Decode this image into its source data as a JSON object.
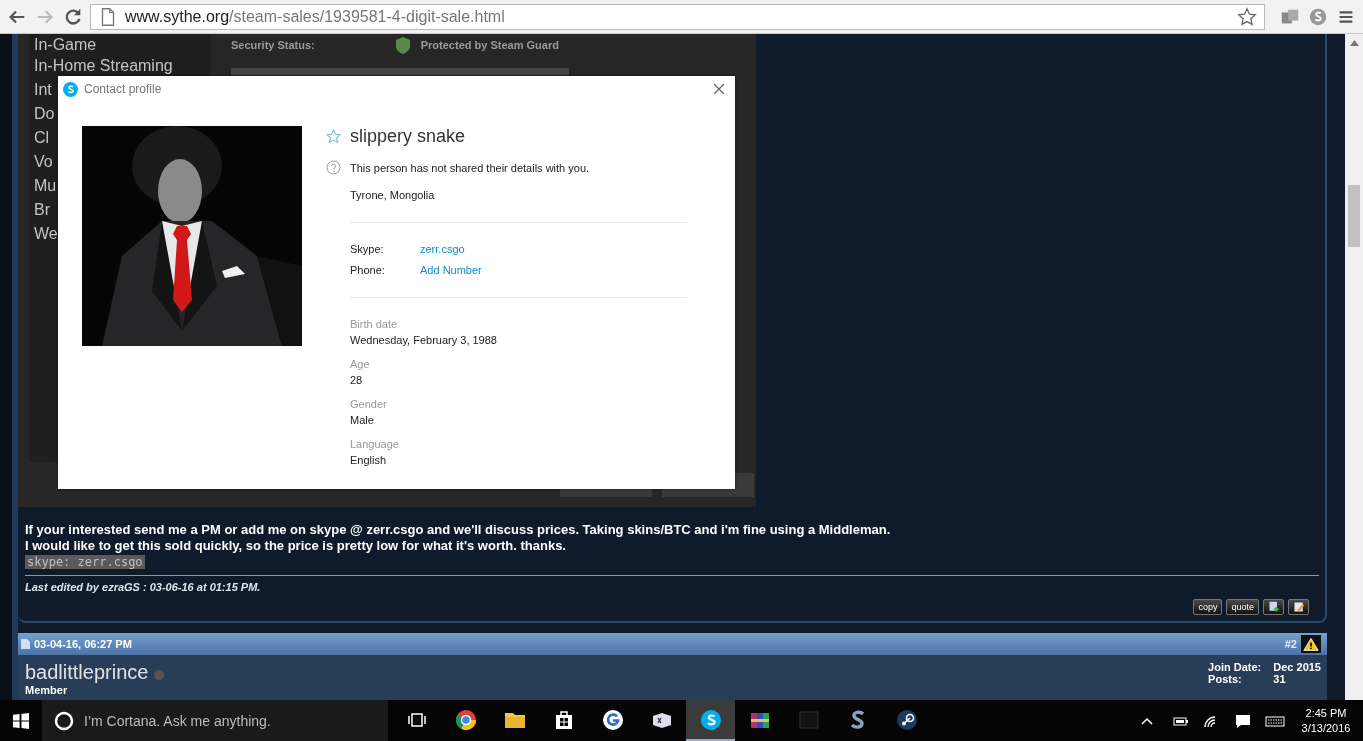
{
  "browser": {
    "url_host": "www.sythe.org",
    "url_path": "/steam-sales/1939581-4-digit-sale.html"
  },
  "steam_screenshot": {
    "security_label": "Security Status:",
    "security_value": "Protected by Steam Guard",
    "menu": [
      "In-Game",
      "In-Home Streaming",
      "Int",
      "Do",
      "Cl",
      "Vo",
      "Mu",
      "Br",
      "We"
    ]
  },
  "dialog": {
    "title": "Contact profile",
    "name": "slippery snake",
    "notice": "This person has not shared their details with you.",
    "location": "Tyrone, Mongolia",
    "contacts": [
      {
        "label": "Skype:",
        "value": "zerr.csgo"
      },
      {
        "label": "Phone:",
        "value": "Add Number"
      }
    ],
    "details": [
      {
        "label": "Birth date",
        "value": "Wednesday, February 3, 1988"
      },
      {
        "label": "Age",
        "value": "28"
      },
      {
        "label": "Gender",
        "value": "Male"
      },
      {
        "label": "Language",
        "value": "English"
      }
    ]
  },
  "post": {
    "lines": [
      "If your interested send me a PM or add me on skype @ zerr.csgo and we'll discuss prices. Taking skins/BTC and i'm fine using a Middleman.",
      "I would like to get this sold quickly, so the price is pretty low for what it's worth. thanks."
    ],
    "highlight": "skype: zerr.csgo",
    "edited": "Last edited by ezraGS : 03-06-16 at 01:15 PM.",
    "buttons": [
      "copy",
      "quote"
    ]
  },
  "next_post": {
    "date": "03-04-16, 06:27 PM",
    "number": "#2",
    "username": "badlittleprince",
    "online": false,
    "rank": "Member",
    "stats": [
      {
        "label": "Join Date:",
        "value": "Dec 2015"
      },
      {
        "label": "Posts:",
        "value": "31"
      }
    ]
  },
  "taskbar": {
    "search_placeholder": "I’m Cortana. Ask me anything.",
    "apps": [
      {
        "selected": false
      },
      {
        "selected": false
      },
      {
        "selected": false
      },
      {
        "selected": false
      },
      {
        "selected": false
      },
      {
        "selected": false
      },
      {
        "selected": true
      },
      {
        "selected": false
      },
      {
        "selected": false
      },
      {
        "selected": false
      },
      {
        "selected": false
      }
    ],
    "time": "2:45 PM",
    "date": "3/13/2016"
  }
}
